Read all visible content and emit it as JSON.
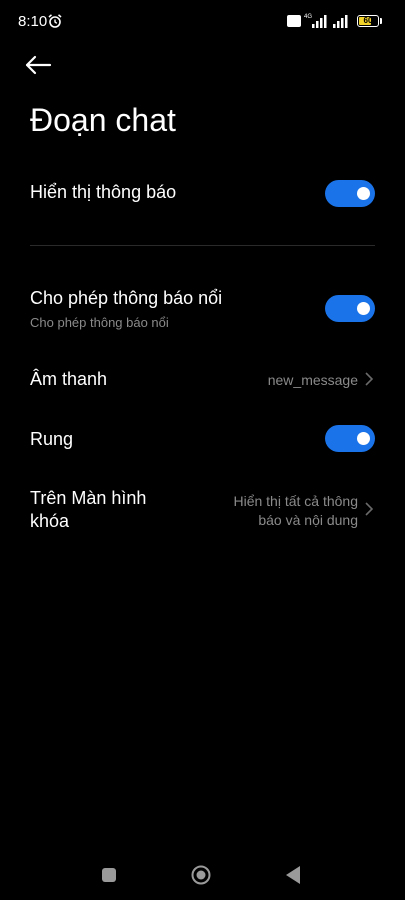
{
  "status_bar": {
    "time": "8:10",
    "battery_level": "60",
    "network_label": "4G"
  },
  "header": {
    "title": "Đoạn chat"
  },
  "settings": {
    "show_notifications": {
      "label": "Hiển thị thông báo",
      "enabled": true
    },
    "floating_notifications": {
      "label": "Cho phép thông báo nổi",
      "subtitle": "Cho phép thông báo nổi",
      "enabled": true
    },
    "sound": {
      "label": "Âm thanh",
      "value": "new_message"
    },
    "vibrate": {
      "label": "Rung",
      "enabled": true
    },
    "lock_screen": {
      "label_line1": "Trên Màn hình",
      "label_line2": "khóa",
      "value_line1": "Hiển thị tất cả thông",
      "value_line2": "báo và nội dung"
    }
  },
  "colors": {
    "toggle_on": "#1a73e8",
    "background": "#000000",
    "secondary_text": "#8a8a8a"
  },
  "icons": {
    "back": "arrow-left-icon",
    "chevron": "chevron-right-icon",
    "alarm": "alarm-clock-icon",
    "nav_recents": "square-icon",
    "nav_home": "circle-icon",
    "nav_back": "triangle-icon"
  }
}
